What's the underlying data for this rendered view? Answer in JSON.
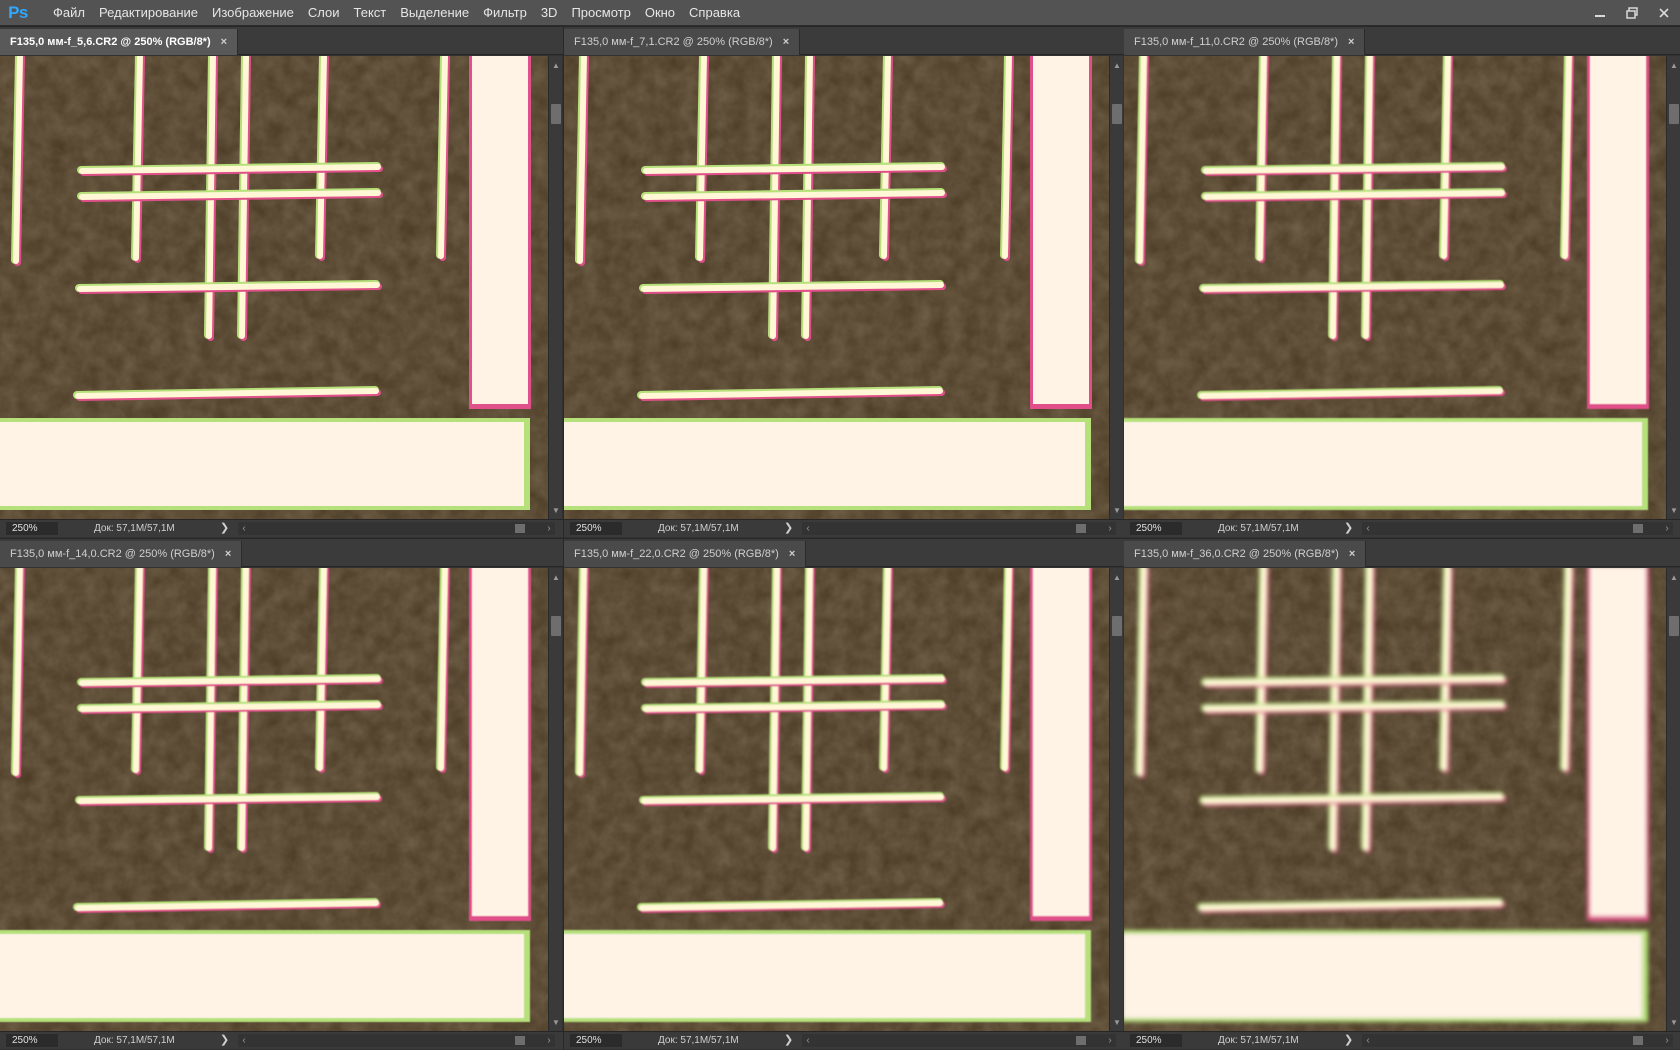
{
  "app": {
    "logo_text": "Ps",
    "menu": [
      "Файл",
      "Редактирование",
      "Изображение",
      "Слои",
      "Текст",
      "Выделение",
      "Фильтр",
      "3D",
      "Просмотр",
      "Окно",
      "Справка"
    ]
  },
  "documents": [
    {
      "title": "F135,0 мм-f_5,6.CR2 @ 250% (RGB/8*)",
      "zoom": "250%",
      "doc_info": "Док: 57,1M/57,1M",
      "close_symbol": "×",
      "active": true,
      "blur": 0.0
    },
    {
      "title": "F135,0 мм-f_7,1.CR2 @ 250% (RGB/8*)",
      "zoom": "250%",
      "doc_info": "Док: 57,1M/57,1M",
      "close_symbol": "×",
      "active": false,
      "blur": 0.2
    },
    {
      "title": "F135,0 мм-f_11,0.CR2 @ 250% (RGB/8*)",
      "zoom": "250%",
      "doc_info": "Док: 57,1M/57,1M",
      "close_symbol": "×",
      "active": false,
      "blur": 0.4
    },
    {
      "title": "F135,0 мм-f_14,0.CR2 @ 250% (RGB/8*)",
      "zoom": "250%",
      "doc_info": "Док: 57,1M/57,1M",
      "close_symbol": "×",
      "active": false,
      "blur": 0.5
    },
    {
      "title": "F135,0 мм-f_22,0.CR2 @ 250% (RGB/8*)",
      "zoom": "250%",
      "doc_info": "Док: 57,1M/57,1M",
      "close_symbol": "×",
      "active": false,
      "blur": 0.8
    },
    {
      "title": "F135,0 мм-f_36,0.CR2 @ 250% (RGB/8*)",
      "zoom": "250%",
      "doc_info": "Док: 57,1M/57,1M",
      "close_symbol": "×",
      "active": false,
      "blur": 2.2
    }
  ],
  "icons": {
    "minimize": "minimize-icon",
    "restore": "restore-icon",
    "close": "close-icon"
  },
  "colors": {
    "menubar_bg": "#535353",
    "canvas_bg": "#4a3a24",
    "line": "#fff7d6",
    "fringe_magenta": "#e0508a",
    "fringe_green": "#b6e07a",
    "panel_fill": "#fff3e6"
  }
}
